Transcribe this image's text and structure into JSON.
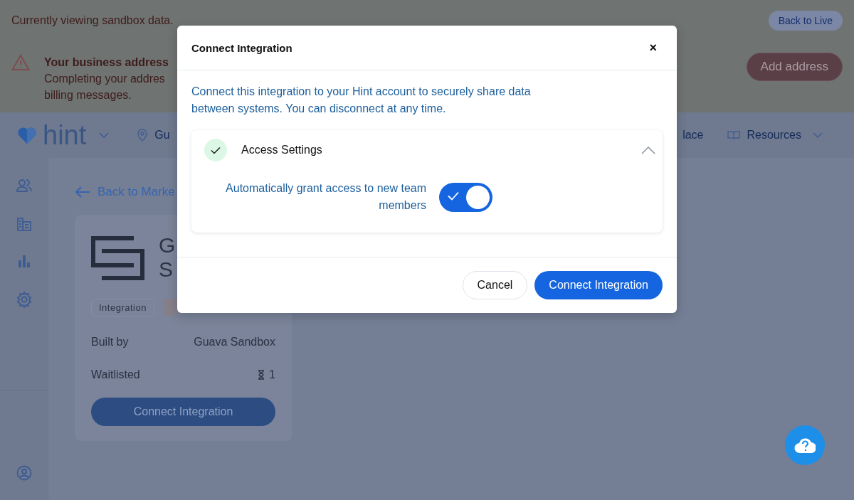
{
  "sandbox_banner": {
    "message": "Currently viewing sandbox data.",
    "back_button": "Back to Live"
  },
  "address_alert": {
    "title": "Your business address",
    "message_lines": [
      "Completing your addres",
      "billing messages."
    ],
    "button": "Add address"
  },
  "top_nav": {
    "brand": "hint",
    "location": "Gu",
    "items": [
      "lace",
      "Resources"
    ]
  },
  "back_link": "Back to Marke",
  "integration_card": {
    "title_lines": [
      "G",
      "S"
    ],
    "tags": [
      "Integration"
    ],
    "details": [
      {
        "label": "Built by",
        "value": "Guava Sandbox",
        "kind": "text"
      },
      {
        "label": "Waitlisted",
        "value": "1",
        "kind": "waitlist"
      }
    ],
    "button": "Connect Integration"
  },
  "modal": {
    "title": "Connect Integration",
    "close": "×",
    "description": "Connect this integration to your Hint account to securely share data between systems. You can disconnect at any time.",
    "section": {
      "title": "Access Settings",
      "complete": true,
      "expanded": true,
      "setting": {
        "label": "Automatically grant access to new team members",
        "on": true
      }
    },
    "buttons": [
      {
        "label": "Cancel",
        "kind": "secondary"
      },
      {
        "label": "Connect Integration",
        "kind": "primary"
      }
    ]
  }
}
